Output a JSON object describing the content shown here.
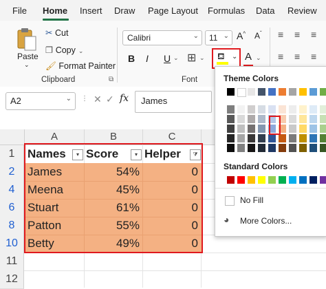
{
  "menu": {
    "items": [
      "File",
      "Home",
      "Insert",
      "Draw",
      "Page Layout",
      "Formulas",
      "Data",
      "Review"
    ]
  },
  "clipboard": {
    "paste": "Paste",
    "cut": "Cut",
    "copy": "Copy",
    "format_painter": "Format Painter",
    "group_label": "Clipboard"
  },
  "font": {
    "family": "Calibri",
    "size": "11",
    "bold": "B",
    "italic": "I",
    "underline": "U",
    "font_color_letter": "A",
    "group_label": "Font"
  },
  "formula_bar": {
    "name_box": "A2",
    "fx": "fx",
    "value": "James"
  },
  "columns": [
    "A",
    "B",
    "C"
  ],
  "rows": [
    "1",
    "2",
    "4",
    "6",
    "8",
    "10",
    "11",
    "12"
  ],
  "table": {
    "headers": [
      "Names",
      "Score",
      "Helper"
    ],
    "rows": [
      {
        "name": "James",
        "score": "54%",
        "helper": "0"
      },
      {
        "name": "Meena",
        "score": "45%",
        "helper": "0"
      },
      {
        "name": "Stuart",
        "score": "61%",
        "helper": "0"
      },
      {
        "name": "Patton",
        "score": "55%",
        "helper": "0"
      },
      {
        "name": "Betty",
        "score": "49%",
        "helper": "0"
      }
    ],
    "fill_color": "#f4b183"
  },
  "color_panel": {
    "theme_title": "Theme Colors",
    "standard_title": "Standard Colors",
    "no_fill": "No Fill",
    "more_colors": "More Colors...",
    "theme_row": [
      "#000000",
      "#ffffff",
      "#e7e6e6",
      "#44546a",
      "#4472c4",
      "#ed7d31",
      "#a5a5a5",
      "#ffc000",
      "#5b9bd5",
      "#70ad47"
    ],
    "theme_columns": [
      [
        "#7f7f7f",
        "#595959",
        "#404040",
        "#262626",
        "#0d0d0d"
      ],
      [
        "#f2f2f2",
        "#d9d9d9",
        "#bfbfbf",
        "#a6a6a6",
        "#808080"
      ],
      [
        "#d0cece",
        "#aeaaaa",
        "#757171",
        "#3a3838",
        "#171616"
      ],
      [
        "#d6dce4",
        "#adb9ca",
        "#8497b0",
        "#333f4f",
        "#222a35"
      ],
      [
        "#d9e1f2",
        "#b4c6e7",
        "#8ea9db",
        "#2f5597",
        "#1f3864"
      ],
      [
        "#fbe4d5",
        "#f8cbad",
        "#f4b183",
        "#c55a11",
        "#843c0c"
      ],
      [
        "#ededed",
        "#dbdbdb",
        "#c9c9c9",
        "#7b7b7b",
        "#525252"
      ],
      [
        "#fff2cc",
        "#ffe699",
        "#ffd966",
        "#bf9000",
        "#7f6000"
      ],
      [
        "#deebf7",
        "#bdd7ee",
        "#9dc3e6",
        "#2e75b6",
        "#1f4e79"
      ],
      [
        "#e2efda",
        "#c6e0b4",
        "#a9d08e",
        "#548235",
        "#375623"
      ]
    ],
    "standard_row": [
      "#c00000",
      "#ff0000",
      "#ffc000",
      "#ffff00",
      "#92d050",
      "#00b050",
      "#00b0f0",
      "#0070c0",
      "#002060",
      "#7030a0"
    ]
  },
  "highlight_color": "#e0191e"
}
